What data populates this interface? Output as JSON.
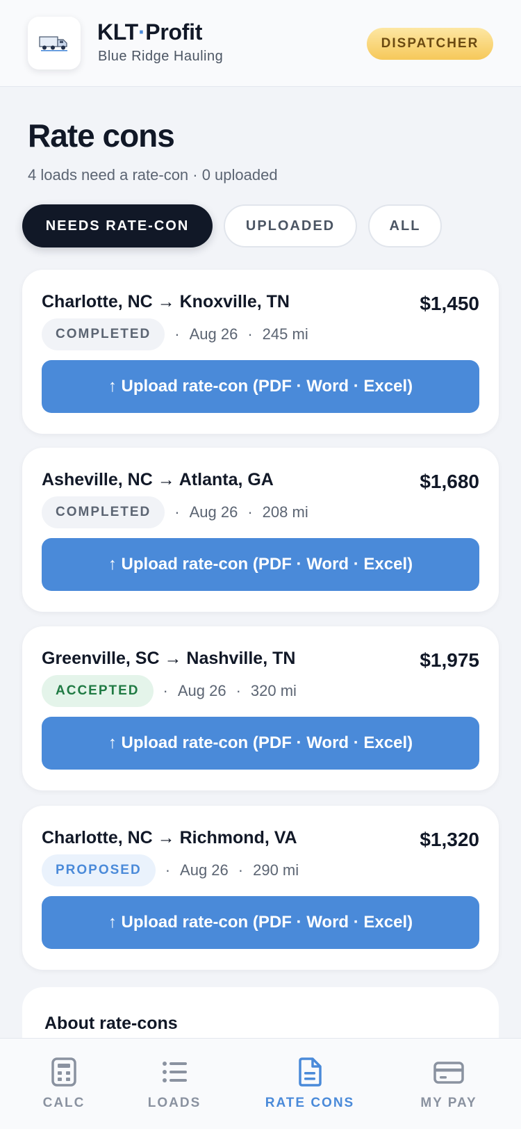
{
  "header": {
    "app_name_left": "KLT",
    "app_name_dot": "·",
    "app_name_right": "Profit",
    "company": "Blue Ridge Hauling",
    "role": "DISPATCHER"
  },
  "page": {
    "title": "Rate cons",
    "subtitle": "4 loads need a rate-con · 0 uploaded"
  },
  "tabs": [
    {
      "label": "NEEDS RATE-CON",
      "active": true
    },
    {
      "label": "UPLOADED",
      "active": false
    },
    {
      "label": "ALL",
      "active": false
    }
  ],
  "loads": [
    {
      "route": "Charlotte, NC → Knoxville, TN",
      "price": "$1,450",
      "status": "COMPLETED",
      "date": "Aug 26",
      "miles": "245 mi",
      "button": "↑ Upload rate-con (PDF · Word · Excel)"
    },
    {
      "route": "Asheville, NC → Atlanta, GA",
      "price": "$1,680",
      "status": "COMPLETED",
      "date": "Aug 26",
      "miles": "208 mi",
      "button": "↑ Upload rate-con (PDF · Word · Excel)"
    },
    {
      "route": "Greenville, SC → Nashville, TN",
      "price": "$1,975",
      "status": "ACCEPTED",
      "date": "Aug 26",
      "miles": "320 mi",
      "button": "↑ Upload rate-con (PDF · Word · Excel)"
    },
    {
      "route": "Charlotte, NC → Richmond, VA",
      "price": "$1,320",
      "status": "PROPOSED",
      "date": "Aug 26",
      "miles": "290 mi",
      "button": "↑ Upload rate-con (PDF · Word · Excel)"
    }
  ],
  "separator": "·",
  "about": {
    "title": "About rate-cons"
  },
  "nav": [
    {
      "label": "CALC",
      "icon": "calculator-icon",
      "active": false
    },
    {
      "label": "LOADS",
      "icon": "list-icon",
      "active": false
    },
    {
      "label": "RATE CONS",
      "icon": "document-icon",
      "active": true
    },
    {
      "label": "MY PAY",
      "icon": "credit-card-icon",
      "active": false
    }
  ],
  "colors": {
    "accent": "#4a8ad9",
    "dark": "#111827",
    "completed_bg": "#f1f3f7",
    "accepted_bg": "#e4f4ea",
    "accepted_fg": "#1f7a43",
    "proposed_bg": "#eaf2fc",
    "badge": "#f6c85a"
  }
}
